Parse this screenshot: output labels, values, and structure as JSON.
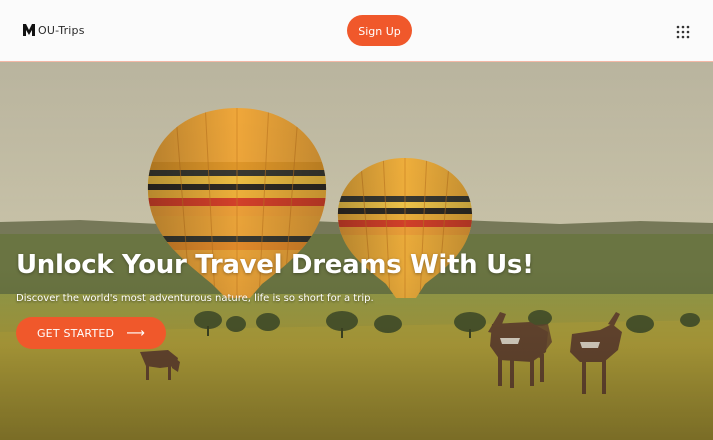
{
  "header": {
    "logo_text": "OU-Trips",
    "logo_icon": "m-logo-mark",
    "signup_label": "Sign Up",
    "menu_icon": "grid-dots-icon"
  },
  "hero": {
    "title": "Unlock Your Travel Dreams With Us!",
    "subtitle": "Discover the world's most adventurous nature, life is so short for a trip.",
    "cta_label": "GET STARTED",
    "cta_icon": "arrow-right-icon",
    "background": "hot-air-balloons-savanna-antelopes-image"
  },
  "colors": {
    "accent": "#f0582b",
    "header_bg": "#fbfbfb",
    "header_border": "#f4b8a6"
  }
}
